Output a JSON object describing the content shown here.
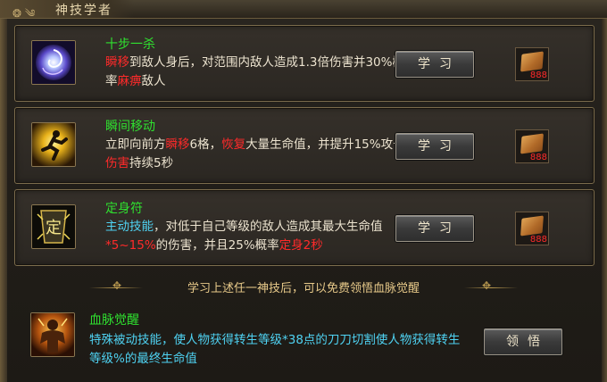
{
  "window": {
    "title": "神技学者"
  },
  "skills": [
    {
      "name": "十步一杀",
      "desc": [
        {
          "t": "瞬移",
          "c": "red"
        },
        {
          "t": "到敌人身后，对范围内敌人造成1.3倍伤害并30%概率",
          "c": ""
        },
        {
          "t": "麻痹",
          "c": "red"
        },
        {
          "t": "敌人",
          "c": ""
        }
      ],
      "button": "学习",
      "cost": "888"
    },
    {
      "name": "瞬间移动",
      "desc": [
        {
          "t": "立即向前方",
          "c": ""
        },
        {
          "t": "瞬移",
          "c": "red"
        },
        {
          "t": "6格，",
          "c": ""
        },
        {
          "t": "恢复",
          "c": "red"
        },
        {
          "t": "大量生命值，并提升15%攻击",
          "c": ""
        },
        {
          "t": "伤害",
          "c": "red"
        },
        {
          "t": "持续5秒",
          "c": ""
        }
      ],
      "button": "学习",
      "cost": "888"
    },
    {
      "name": "定身符",
      "desc": [
        {
          "t": "主动技能",
          "c": "cyan"
        },
        {
          "t": "，对低于自己等级的敌人造成其最大生命值",
          "c": ""
        },
        {
          "t": "*5~15%",
          "c": "red"
        },
        {
          "t": "的伤害，并且25%概率",
          "c": ""
        },
        {
          "t": "定身2秒",
          "c": "red"
        }
      ],
      "button": "学习",
      "cost": "888"
    }
  ],
  "divider": {
    "text": "学习上述任一神技后，可以免费领悟血脉觉醒"
  },
  "bloodline": {
    "name": "血脉觉醒",
    "desc": "特殊被动技能，使人物获得转生等级*38点的刀刀切割使人物获得转生等级%的最终生命值",
    "button": "领悟"
  },
  "colors": {
    "name": "#2fe02f",
    "highlight": "#ff2a2a",
    "cyan": "#4fd2f2",
    "text": "#ece3cf"
  }
}
